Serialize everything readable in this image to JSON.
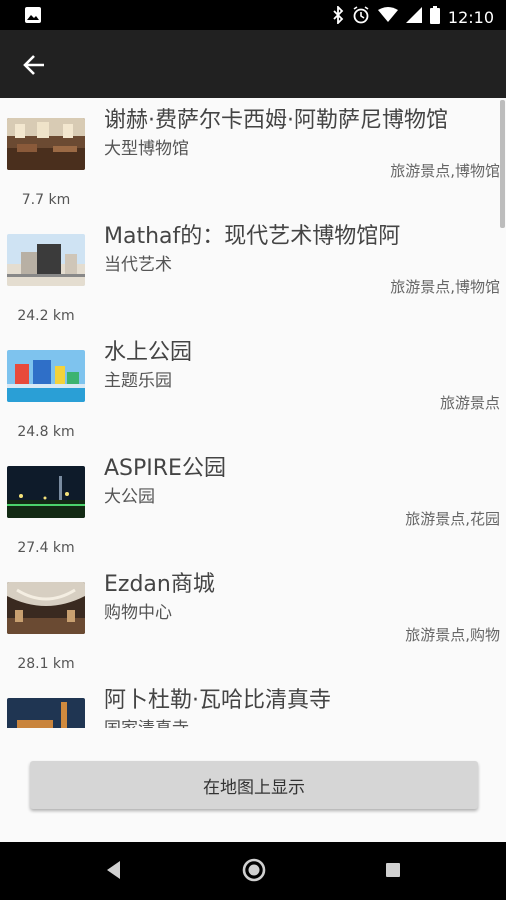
{
  "status_bar": {
    "time": "12:10",
    "icons": [
      "image-icon",
      "bluetooth-icon",
      "alarm-icon",
      "wifi-icon",
      "signal-icon",
      "battery-icon"
    ]
  },
  "app_bar": {
    "back_icon": "arrow-back-icon"
  },
  "places": [
    {
      "name": "谢赫·费萨尔卡西姆·阿勒萨尼博物馆",
      "category": "大型博物馆",
      "tags": "旅游景点,博物馆",
      "distance": "7.7 km"
    },
    {
      "name": "Mathaf的：现代艺术博物馆阿",
      "category": "当代艺术",
      "tags": "旅游景点,博物馆",
      "distance": "24.2 km"
    },
    {
      "name": "水上公园",
      "category": "主题乐园",
      "tags": "旅游景点",
      "distance": "24.8 km"
    },
    {
      "name": "ASPIRE公园",
      "category": "大公园",
      "tags": "旅游景点,花园",
      "distance": "27.4 km"
    },
    {
      "name": "Ezdan商城",
      "category": "购物中心",
      "tags": "旅游景点,购物",
      "distance": "28.1 km"
    },
    {
      "name": "阿卜杜勒·瓦哈比清真寺",
      "category": "国家清真寺",
      "tags": "",
      "distance": ""
    }
  ],
  "footer": {
    "map_button_label": "在地图上显示"
  },
  "nav_bar": {
    "icons": [
      "back-triangle-icon",
      "home-circle-icon",
      "recents-square-icon"
    ]
  }
}
